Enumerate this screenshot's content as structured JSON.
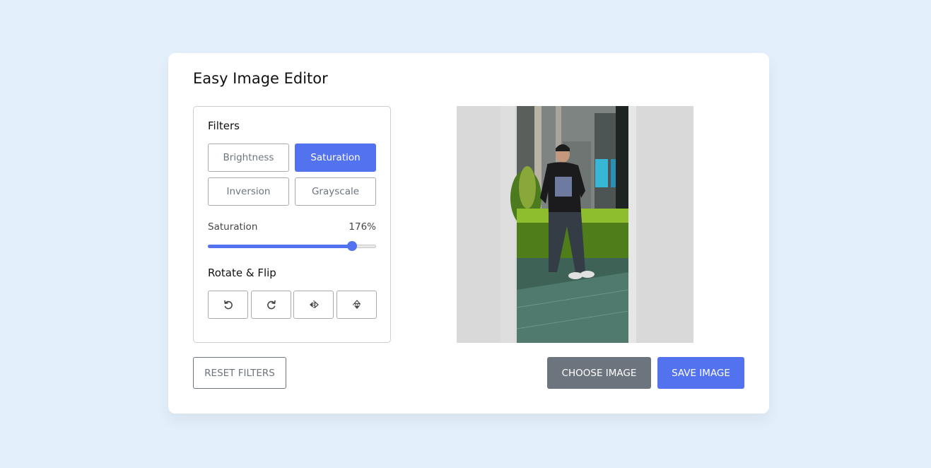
{
  "app": {
    "title": "Easy Image Editor"
  },
  "filters": {
    "title": "Filters",
    "buttons": [
      {
        "label": "Brightness",
        "active": false
      },
      {
        "label": "Saturation",
        "active": true
      },
      {
        "label": "Inversion",
        "active": false
      },
      {
        "label": "Grayscale",
        "active": false
      }
    ]
  },
  "slider": {
    "label": "Saturation",
    "value_text": "176%",
    "value": 176,
    "max": 200
  },
  "rotate": {
    "title": "Rotate & Flip",
    "buttons": [
      {
        "icon": "rotate-left-icon"
      },
      {
        "icon": "rotate-right-icon"
      },
      {
        "icon": "flip-horizontal-icon"
      },
      {
        "icon": "flip-vertical-icon"
      }
    ]
  },
  "actions": {
    "reset_label": "RESET FILTERS",
    "choose_label": "CHOOSE IMAGE",
    "save_label": "SAVE IMAGE"
  },
  "colors": {
    "accent": "#5372f0",
    "secondary": "#6c757d",
    "background": "#e3f0fc"
  }
}
